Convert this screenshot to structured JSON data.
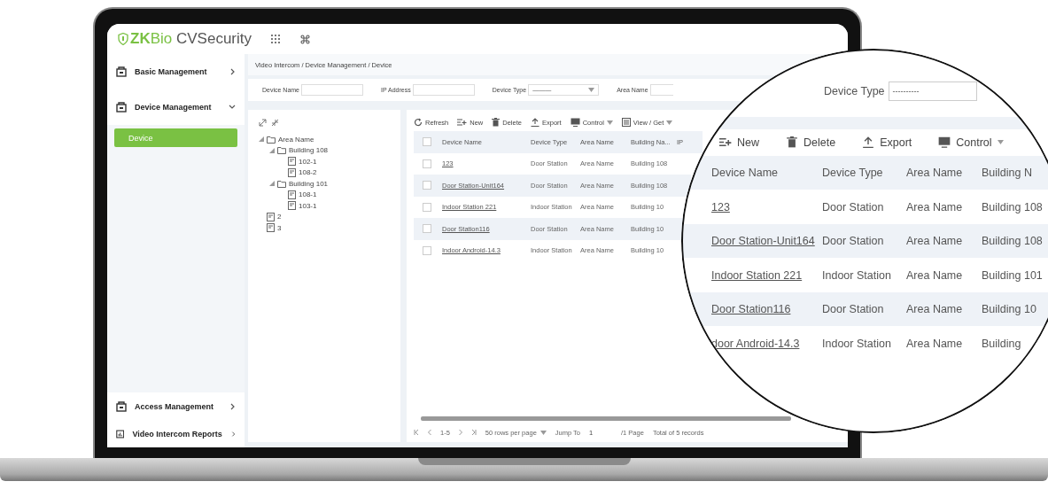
{
  "header": {
    "logo_prefix": "ZK",
    "logo_mid": "Bio",
    "logo_suffix": " CVSecurity"
  },
  "sidebar": {
    "top": [
      {
        "label": "Basic Management",
        "expanded": false
      },
      {
        "label": "Device Management",
        "expanded": true,
        "children": [
          {
            "label": "Device",
            "selected": true
          }
        ]
      }
    ],
    "bottom": [
      {
        "label": "Access Management",
        "expanded": false
      },
      {
        "label": "Video Intercom Reports",
        "expanded": false
      }
    ]
  },
  "breadcrumb": "Video Intercom / Device Management / Device",
  "filters": [
    {
      "label": "Device Name",
      "kind": "text"
    },
    {
      "label": "IP Address",
      "kind": "text"
    },
    {
      "label": "Device Type",
      "kind": "select",
      "value": "———"
    },
    {
      "label": "Area Name",
      "kind": "text"
    }
  ],
  "tree": [
    {
      "label": "Area Name",
      "kind": "folder",
      "expanded": true,
      "children": [
        {
          "label": "Building 108",
          "kind": "folder",
          "expanded": true,
          "children": [
            {
              "label": "102-1",
              "kind": "device"
            },
            {
              "label": "108-2",
              "kind": "device"
            }
          ]
        },
        {
          "label": "Building 101",
          "kind": "folder",
          "expanded": true,
          "children": [
            {
              "label": "108-1",
              "kind": "device"
            },
            {
              "label": "103-1",
              "kind": "device"
            }
          ]
        }
      ]
    },
    {
      "label": "2",
      "kind": "device"
    },
    {
      "label": "3",
      "kind": "device"
    }
  ],
  "toolbar": [
    {
      "label": "Refresh",
      "kind": "button"
    },
    {
      "label": "New",
      "kind": "button"
    },
    {
      "label": "Delete",
      "kind": "button"
    },
    {
      "label": "Export",
      "kind": "button"
    },
    {
      "label": "Control",
      "kind": "dropdown"
    },
    {
      "label": "View / Get",
      "kind": "dropdown"
    }
  ],
  "table": {
    "all_checked": false,
    "columns": [
      "Device Name",
      "Device Type",
      "Area Name",
      "Building Na...",
      "IP"
    ],
    "rows": [
      {
        "checked": false,
        "cells": [
          "123",
          "Door Station",
          "Area Name",
          "Building 108"
        ]
      },
      {
        "checked": false,
        "cells": [
          "Door Station-Unit164",
          "Door Station",
          "Area Name",
          "Building 108"
        ]
      },
      {
        "checked": false,
        "cells": [
          "Indoor Station 221",
          "Indoor Station",
          "Area Name",
          "Building 10"
        ]
      },
      {
        "checked": false,
        "cells": [
          "Door Station116",
          "Door Station",
          "Area Name",
          "Building 10"
        ]
      },
      {
        "checked": false,
        "cells": [
          "Indoor Android-14.3",
          "Indoor Station",
          "Area Name",
          "Building 10"
        ]
      }
    ]
  },
  "pagination": {
    "range": "1-5",
    "page_size": "50 rows per page",
    "jump_label": "Jump To",
    "jump_value": "1",
    "pages": "/1 Page",
    "total": "Total of 5 records"
  },
  "magnifier": {
    "filter": {
      "label": "Device Type",
      "value": "----------"
    },
    "toolbar": [
      {
        "label": "New",
        "kind": "button"
      },
      {
        "label": "Delete",
        "kind": "button"
      },
      {
        "label": "Export",
        "kind": "button"
      },
      {
        "label": "Control",
        "kind": "dropdown"
      }
    ],
    "columns": [
      "Device Name",
      "Device Type",
      "Area Name",
      "Building N"
    ],
    "rows": [
      {
        "cells": [
          "123",
          "Door Station",
          "Area Name",
          "Building 108"
        ]
      },
      {
        "cells": [
          "Door Station-Unit164",
          "Door Station",
          "Area Name",
          "Building 108"
        ]
      },
      {
        "cells": [
          "Indoor Station 221",
          "Indoor Station",
          "Area Name",
          "Building 101"
        ]
      },
      {
        "cells": [
          "Door Station116",
          "Door Station",
          "Area Name",
          "Building 10"
        ]
      },
      {
        "cells": [
          "door Android-14.3",
          "Indoor Station",
          "Area Name",
          "Building"
        ]
      }
    ]
  }
}
